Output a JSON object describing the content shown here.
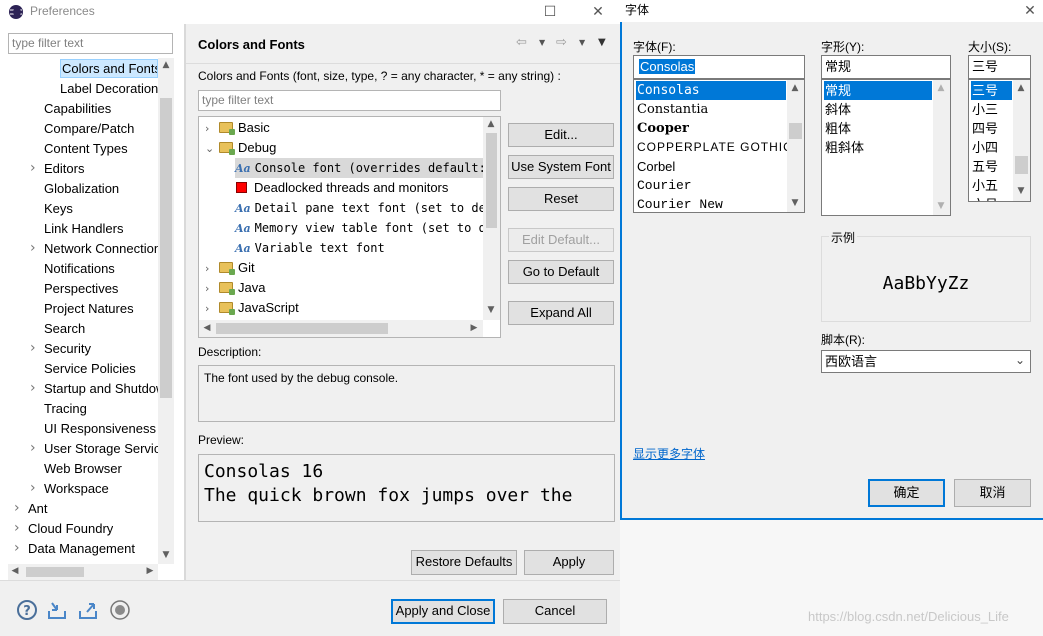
{
  "preferences": {
    "title": "Preferences",
    "filter_placeholder": "type filter text",
    "nav_items": [
      {
        "label": "Colors and Fonts",
        "level": 2,
        "chevron": false,
        "selected": true
      },
      {
        "label": "Label Decorations",
        "level": 2,
        "chevron": false
      },
      {
        "label": "Capabilities",
        "level": 1,
        "chevron": false
      },
      {
        "label": "Compare/Patch",
        "level": 1,
        "chevron": false
      },
      {
        "label": "Content Types",
        "level": 1,
        "chevron": false
      },
      {
        "label": "Editors",
        "level": 1,
        "chevron": true
      },
      {
        "label": "Globalization",
        "level": 1,
        "chevron": false
      },
      {
        "label": "Keys",
        "level": 1,
        "chevron": false
      },
      {
        "label": "Link Handlers",
        "level": 1,
        "chevron": false
      },
      {
        "label": "Network Connections",
        "level": 1,
        "chevron": true
      },
      {
        "label": "Notifications",
        "level": 1,
        "chevron": false
      },
      {
        "label": "Perspectives",
        "level": 1,
        "chevron": false
      },
      {
        "label": "Project Natures",
        "level": 1,
        "chevron": false
      },
      {
        "label": "Search",
        "level": 1,
        "chevron": false
      },
      {
        "label": "Security",
        "level": 1,
        "chevron": true
      },
      {
        "label": "Service Policies",
        "level": 1,
        "chevron": false
      },
      {
        "label": "Startup and Shutdown",
        "level": 1,
        "chevron": true
      },
      {
        "label": "Tracing",
        "level": 1,
        "chevron": false
      },
      {
        "label": "UI Responsiveness",
        "level": 1,
        "chevron": false
      },
      {
        "label": "User Storage Service",
        "level": 1,
        "chevron": true
      },
      {
        "label": "Web Browser",
        "level": 1,
        "chevron": false
      },
      {
        "label": "Workspace",
        "level": 1,
        "chevron": true
      },
      {
        "label": "Ant",
        "level": 0,
        "chevron": true
      },
      {
        "label": "Cloud Foundry",
        "level": 0,
        "chevron": true
      },
      {
        "label": "Data Management",
        "level": 0,
        "chevron": true
      }
    ],
    "page_title": "Colors and Fonts",
    "page_intro": "Colors and Fonts (font, size, type, ? = any character, * = any string) :",
    "tree_filter_placeholder": "type filter text",
    "tree": [
      {
        "label": "Basic",
        "kind": "folder",
        "expanded": false,
        "depth": 0
      },
      {
        "label": "Debug",
        "kind": "folder",
        "expanded": true,
        "depth": 0
      },
      {
        "label": "Console font (overrides default: ",
        "kind": "font",
        "depth": 1,
        "selected": true
      },
      {
        "label": "Deadlocked threads and monitors",
        "kind": "color",
        "depth": 1,
        "color": "#ff0000"
      },
      {
        "label": "Detail pane text font (set to def",
        "kind": "font",
        "depth": 1
      },
      {
        "label": "Memory view table font (set to de",
        "kind": "font",
        "depth": 1
      },
      {
        "label": "Variable text font",
        "kind": "font",
        "depth": 1
      },
      {
        "label": "Git",
        "kind": "folder",
        "expanded": false,
        "depth": 0
      },
      {
        "label": "Java",
        "kind": "folder",
        "expanded": false,
        "depth": 0
      },
      {
        "label": "JavaScript",
        "kind": "folder",
        "expanded": false,
        "depth": 0
      }
    ],
    "buttons": {
      "edit": "Edit...",
      "use_system_font": "Use System Font",
      "reset": "Reset",
      "edit_default": "Edit Default...",
      "go_to_default": "Go to Default",
      "expand_all": "Expand All"
    },
    "description_label": "Description:",
    "description_text": "The font used by the debug console.",
    "preview_label": "Preview:",
    "preview_line1": "Consolas 16",
    "preview_line2": "The quick brown fox jumps over the",
    "restore_defaults": "Restore Defaults",
    "apply": "Apply",
    "apply_and_close": "Apply and Close",
    "cancel": "Cancel"
  },
  "font_dialog": {
    "title": "字体",
    "font_label": "字体(F):",
    "font_value": "Consolas",
    "fonts": [
      "Consolas",
      "Constantia",
      "Cooper",
      "COPPERPLATE GOTHIC",
      "Corbel",
      "Courier",
      "Courier New"
    ],
    "style_label": "字形(Y):",
    "style_value": "常规",
    "styles": [
      "常规",
      "斜体",
      "粗体",
      "粗斜体"
    ],
    "size_label": "大小(S):",
    "size_value": "三号",
    "sizes": [
      "三号",
      "小三",
      "四号",
      "小四",
      "五号",
      "小五",
      "六号"
    ],
    "sample_label": "示例",
    "sample_text": "AaBbYyZz",
    "script_label": "脚本(R):",
    "script_value": "西欧语言",
    "more_fonts": "显示更多字体",
    "ok": "确定",
    "cancel": "取消",
    "watermark": "https://blog.csdn.net/Delicious_Life"
  },
  "colors": {
    "accent": "#0078d7",
    "link": "#0066cc",
    "deadlock_swatch": "#ff0000"
  }
}
